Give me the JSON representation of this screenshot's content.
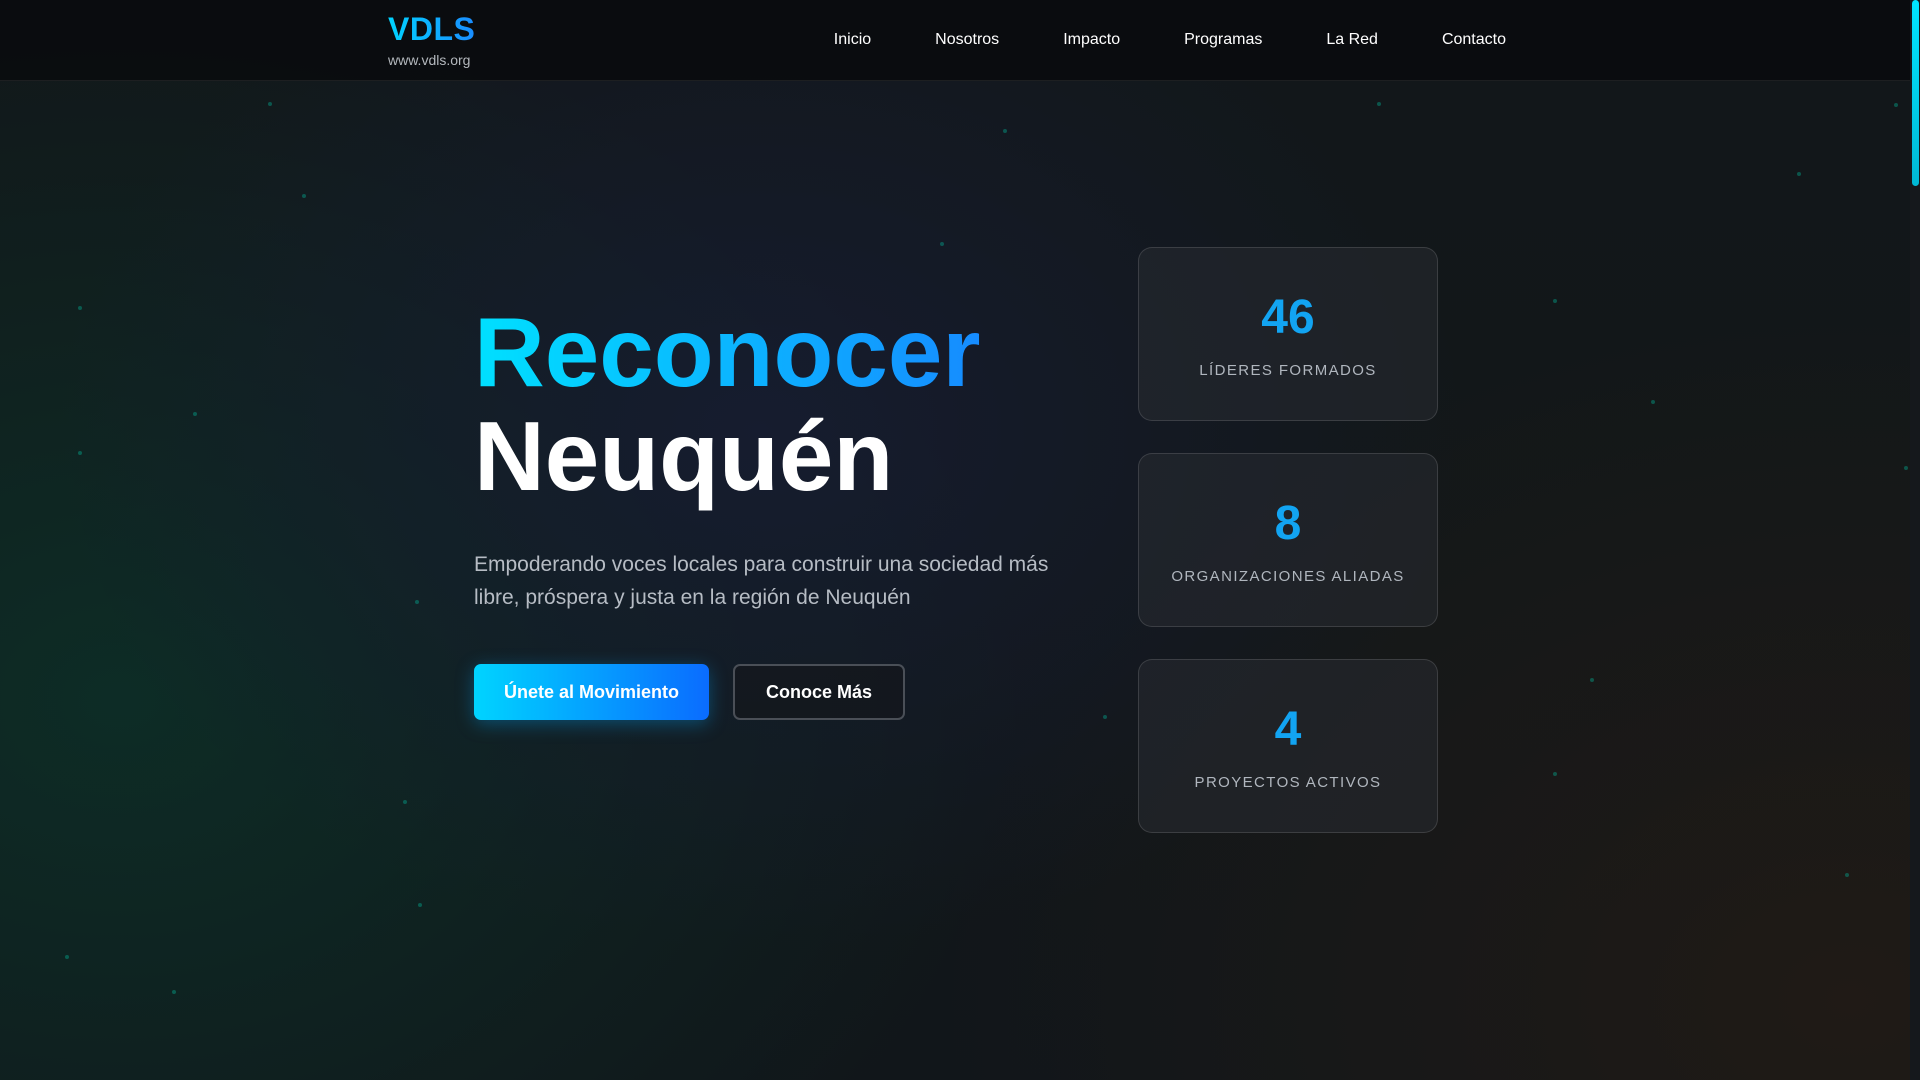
{
  "header": {
    "brand_name": "VDLS",
    "brand_url": "www.vdls.org",
    "nav": [
      "Inicio",
      "Nosotros",
      "Impacto",
      "Programas",
      "La Red",
      "Contacto"
    ]
  },
  "hero": {
    "title_accent": "Reconocer",
    "title_main": "Neuquén",
    "subtitle": "Empoderando voces locales para construir una sociedad más libre, próspera y justa en la región de Neuquén",
    "primary_button": "Únete al Movimiento",
    "secondary_button": "Conoce Más"
  },
  "stats": [
    {
      "number": "46",
      "label": "LÍDERES FORMADOS"
    },
    {
      "number": "8",
      "label": "ORGANIZACIONES ALIADAS"
    },
    {
      "number": "4",
      "label": "PROYECTOS ACTIVOS"
    }
  ],
  "colors": {
    "accent_start": "#00d4ff",
    "accent_end": "#1a7cff",
    "stat_number": "#12a4f2",
    "scroll_thumb": "#00e5ff"
  }
}
